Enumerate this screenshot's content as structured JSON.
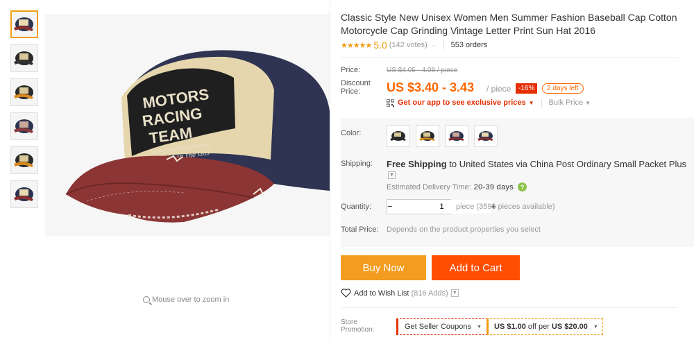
{
  "gallery": {
    "zoom_hint": "Mouse over to zoom in",
    "thumb_colors": [
      "#8b2e2e",
      "#2a2a2a",
      "#d98a1e",
      "#8a3a3a",
      "#d98a1e",
      "#8b2e2e"
    ],
    "main_image_text": {
      "line1": "MOTORS",
      "line2": "RACING",
      "line3": "TEAM",
      "line4": "WORLD SERIES GENUINE",
      "line5": "Ship on the Gas"
    }
  },
  "product": {
    "title": "Classic Style New Unisex Women Men Summer Fashion Baseball Cap Cotton Motorcycle Cap Grinding Vintage Letter Print Sun Hat 2016",
    "stars": "★★★★★",
    "rating": "5.0",
    "votes": "(142 votes)",
    "orders": "553 orders"
  },
  "pricing": {
    "price_label": "Price:",
    "original_price": "US $4.05 - 4.08 / piece",
    "discount_label_1": "Discount",
    "discount_label_2": "Price:",
    "discount_price": "US $3.40 - 3.43",
    "per_piece": "/ piece",
    "discount_badge": "-16%",
    "time_left": "2 days left",
    "app_promo": "Get our app to see exclusive prices",
    "bulk_price": "Bulk Price"
  },
  "options": {
    "color_label": "Color:",
    "swatch_colors": [
      "#2a2a2a",
      "#d98a1e",
      "#8b2e2e",
      "#8b2e2e"
    ],
    "shipping_label": "Shipping:",
    "shipping_free": "Free Shipping",
    "shipping_rest": "to United States via China Post Ordinary Small Packet Plus",
    "est_delivery_label": "Estimated Delivery Time:",
    "est_delivery_days": "20-39 days",
    "quantity_label": "Quantity:",
    "quantity_value": "1",
    "quantity_note": "piece (3596 pieces available)",
    "total_label": "Total Price:",
    "total_value": "Depends on the product properties you select"
  },
  "actions": {
    "buy_now": "Buy Now",
    "add_to_cart": "Add to Cart",
    "wish_list": "Add to Wish List",
    "wish_count": "(816 Adds)"
  },
  "promotion": {
    "label_1": "Store",
    "label_2": "Promotion:",
    "coupon_button": "Get Seller Coupons",
    "deal_amount": "US $1.00",
    "deal_mid": "off per",
    "deal_threshold": "US $20.00"
  },
  "colors": {
    "accent_orange": "#ff6600",
    "buy_now_bg": "#f39c1f",
    "cart_bg": "#ff4e00",
    "badge_red": "#e62e04",
    "star": "#f39c12"
  }
}
